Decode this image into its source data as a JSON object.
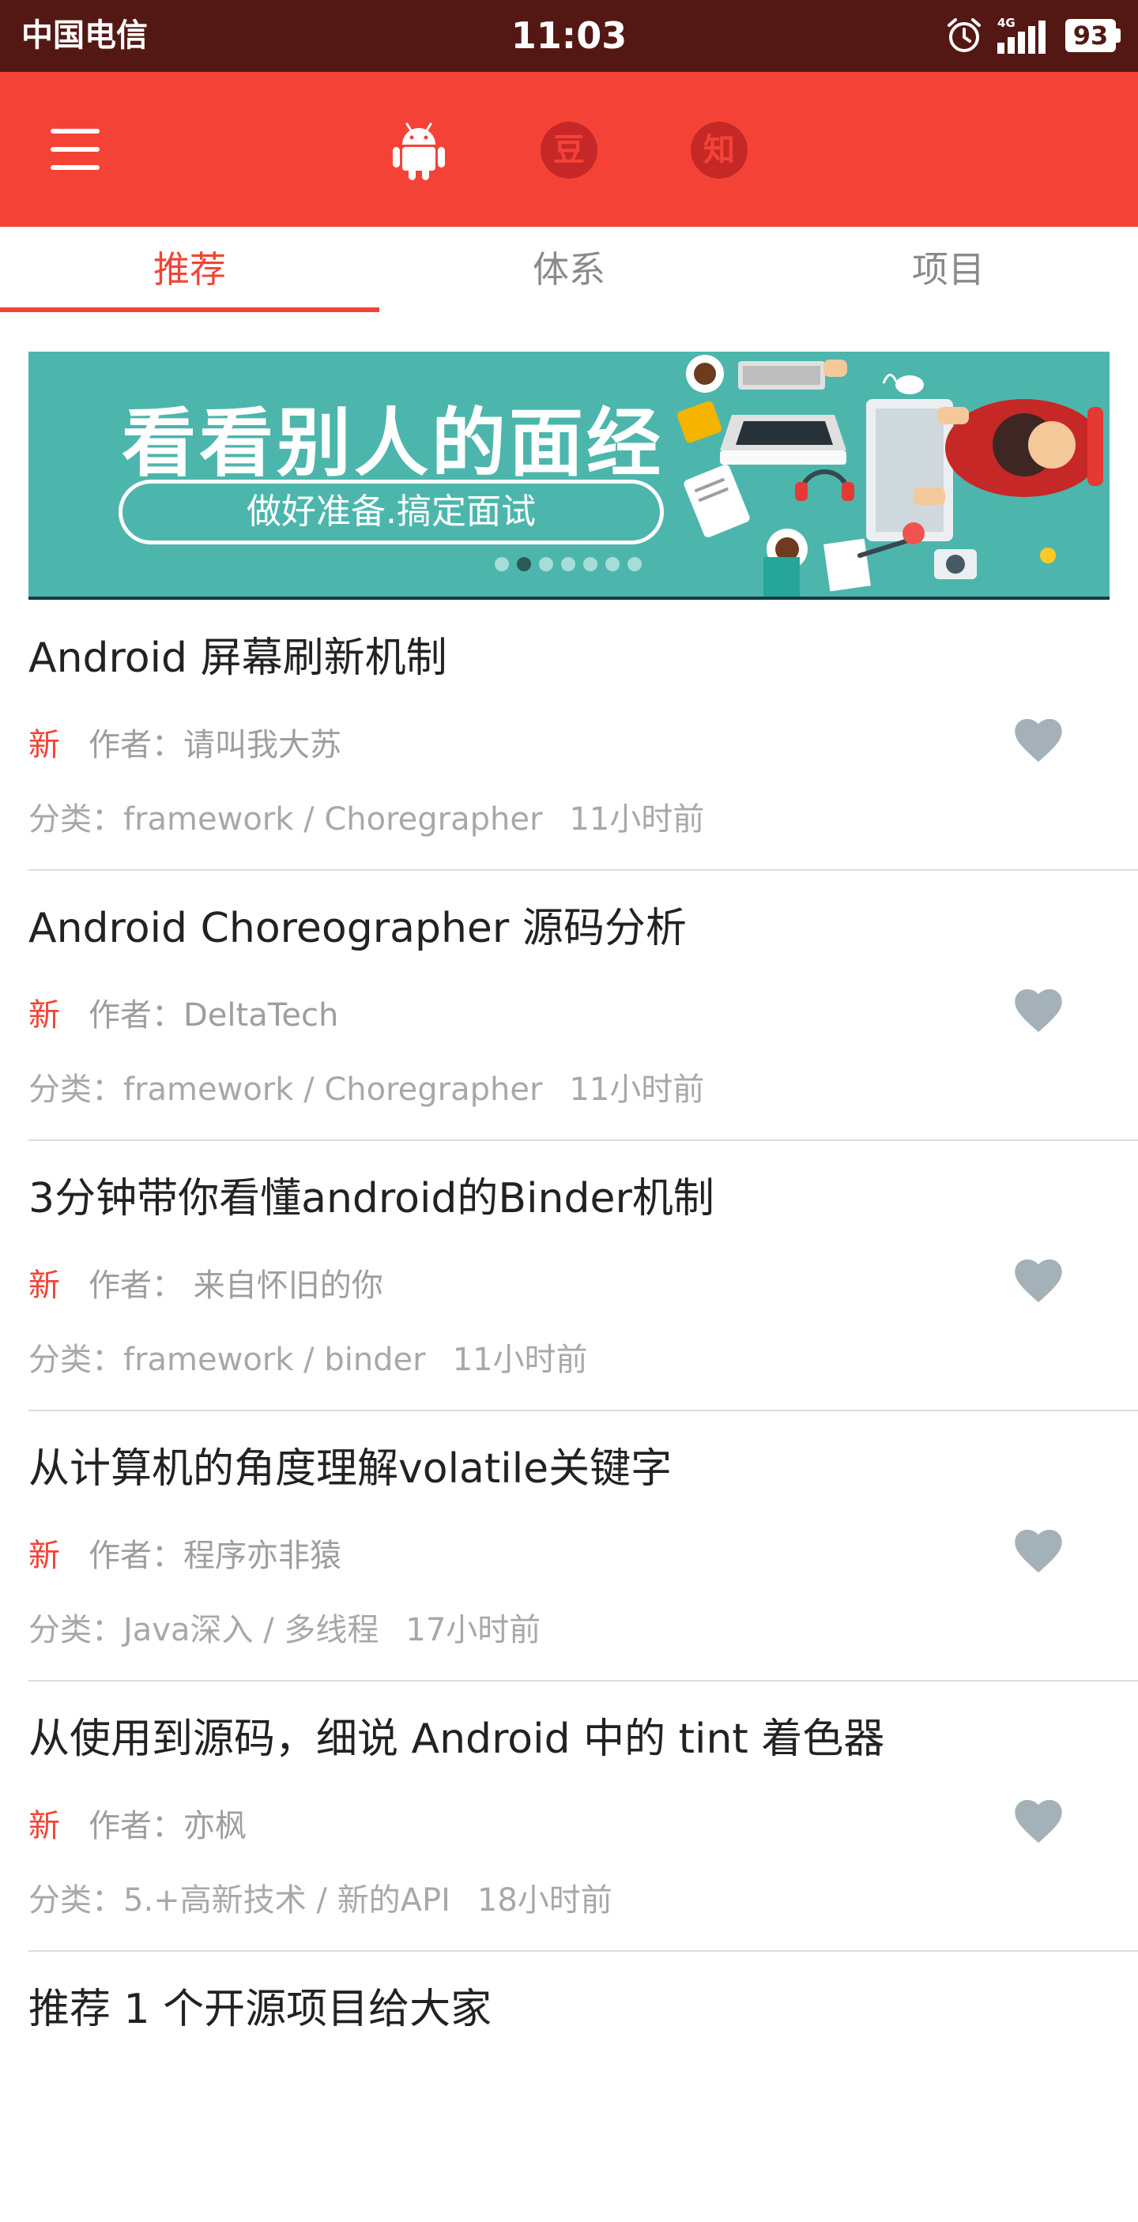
{
  "status_bar": {
    "carrier": "中国电信",
    "time": "11:03",
    "network": "4G",
    "battery": "93"
  },
  "toolbar": {
    "icons": [
      "menu-icon",
      "android-icon",
      "douban-icon",
      "zhihu-icon"
    ],
    "douban_glyph": "豆",
    "zhihu_glyph": "知",
    "colors": {
      "primary": "#f44336",
      "status_bar": "#541814"
    }
  },
  "tabs": [
    {
      "label": "推荐",
      "active": true
    },
    {
      "label": "体系",
      "active": false
    },
    {
      "label": "项目",
      "active": false
    }
  ],
  "banner": {
    "title": "看看别人的面经",
    "subtitle": "做好准备.搞定面试",
    "page_count": 7,
    "active_page": 2,
    "background": "#4db6ac"
  },
  "articles": [
    {
      "title": "Android 屏幕刷新机制",
      "badge": "新",
      "author": "作者：请叫我大苏",
      "category": "分类：framework / Choregrapher",
      "time": "11小时前"
    },
    {
      "title": "Android Choreographer 源码分析",
      "badge": "新",
      "author": "作者：DeltaTech",
      "category": "分类：framework / Choregrapher",
      "time": "11小时前"
    },
    {
      "title": "3分钟带你看懂android的Binder机制",
      "badge": "新",
      "author": "作者： 来自怀旧的你",
      "category": "分类：framework / binder",
      "time": "11小时前"
    },
    {
      "title": "从计算机的角度理解volatile关键字",
      "badge": "新",
      "author": "作者：程序亦非猿",
      "category": "分类：Java深入 / 多线程",
      "time": "17小时前"
    },
    {
      "title": "从使用到源码，细说 Android 中的 tint 着色器",
      "badge": "新",
      "author": "作者：亦枫",
      "category": "分类：5.+高新技术 / 新的API",
      "time": "18小时前"
    },
    {
      "title": "推荐 1 个开源项目给大家",
      "badge": "",
      "author": "",
      "category": "",
      "time": ""
    }
  ]
}
